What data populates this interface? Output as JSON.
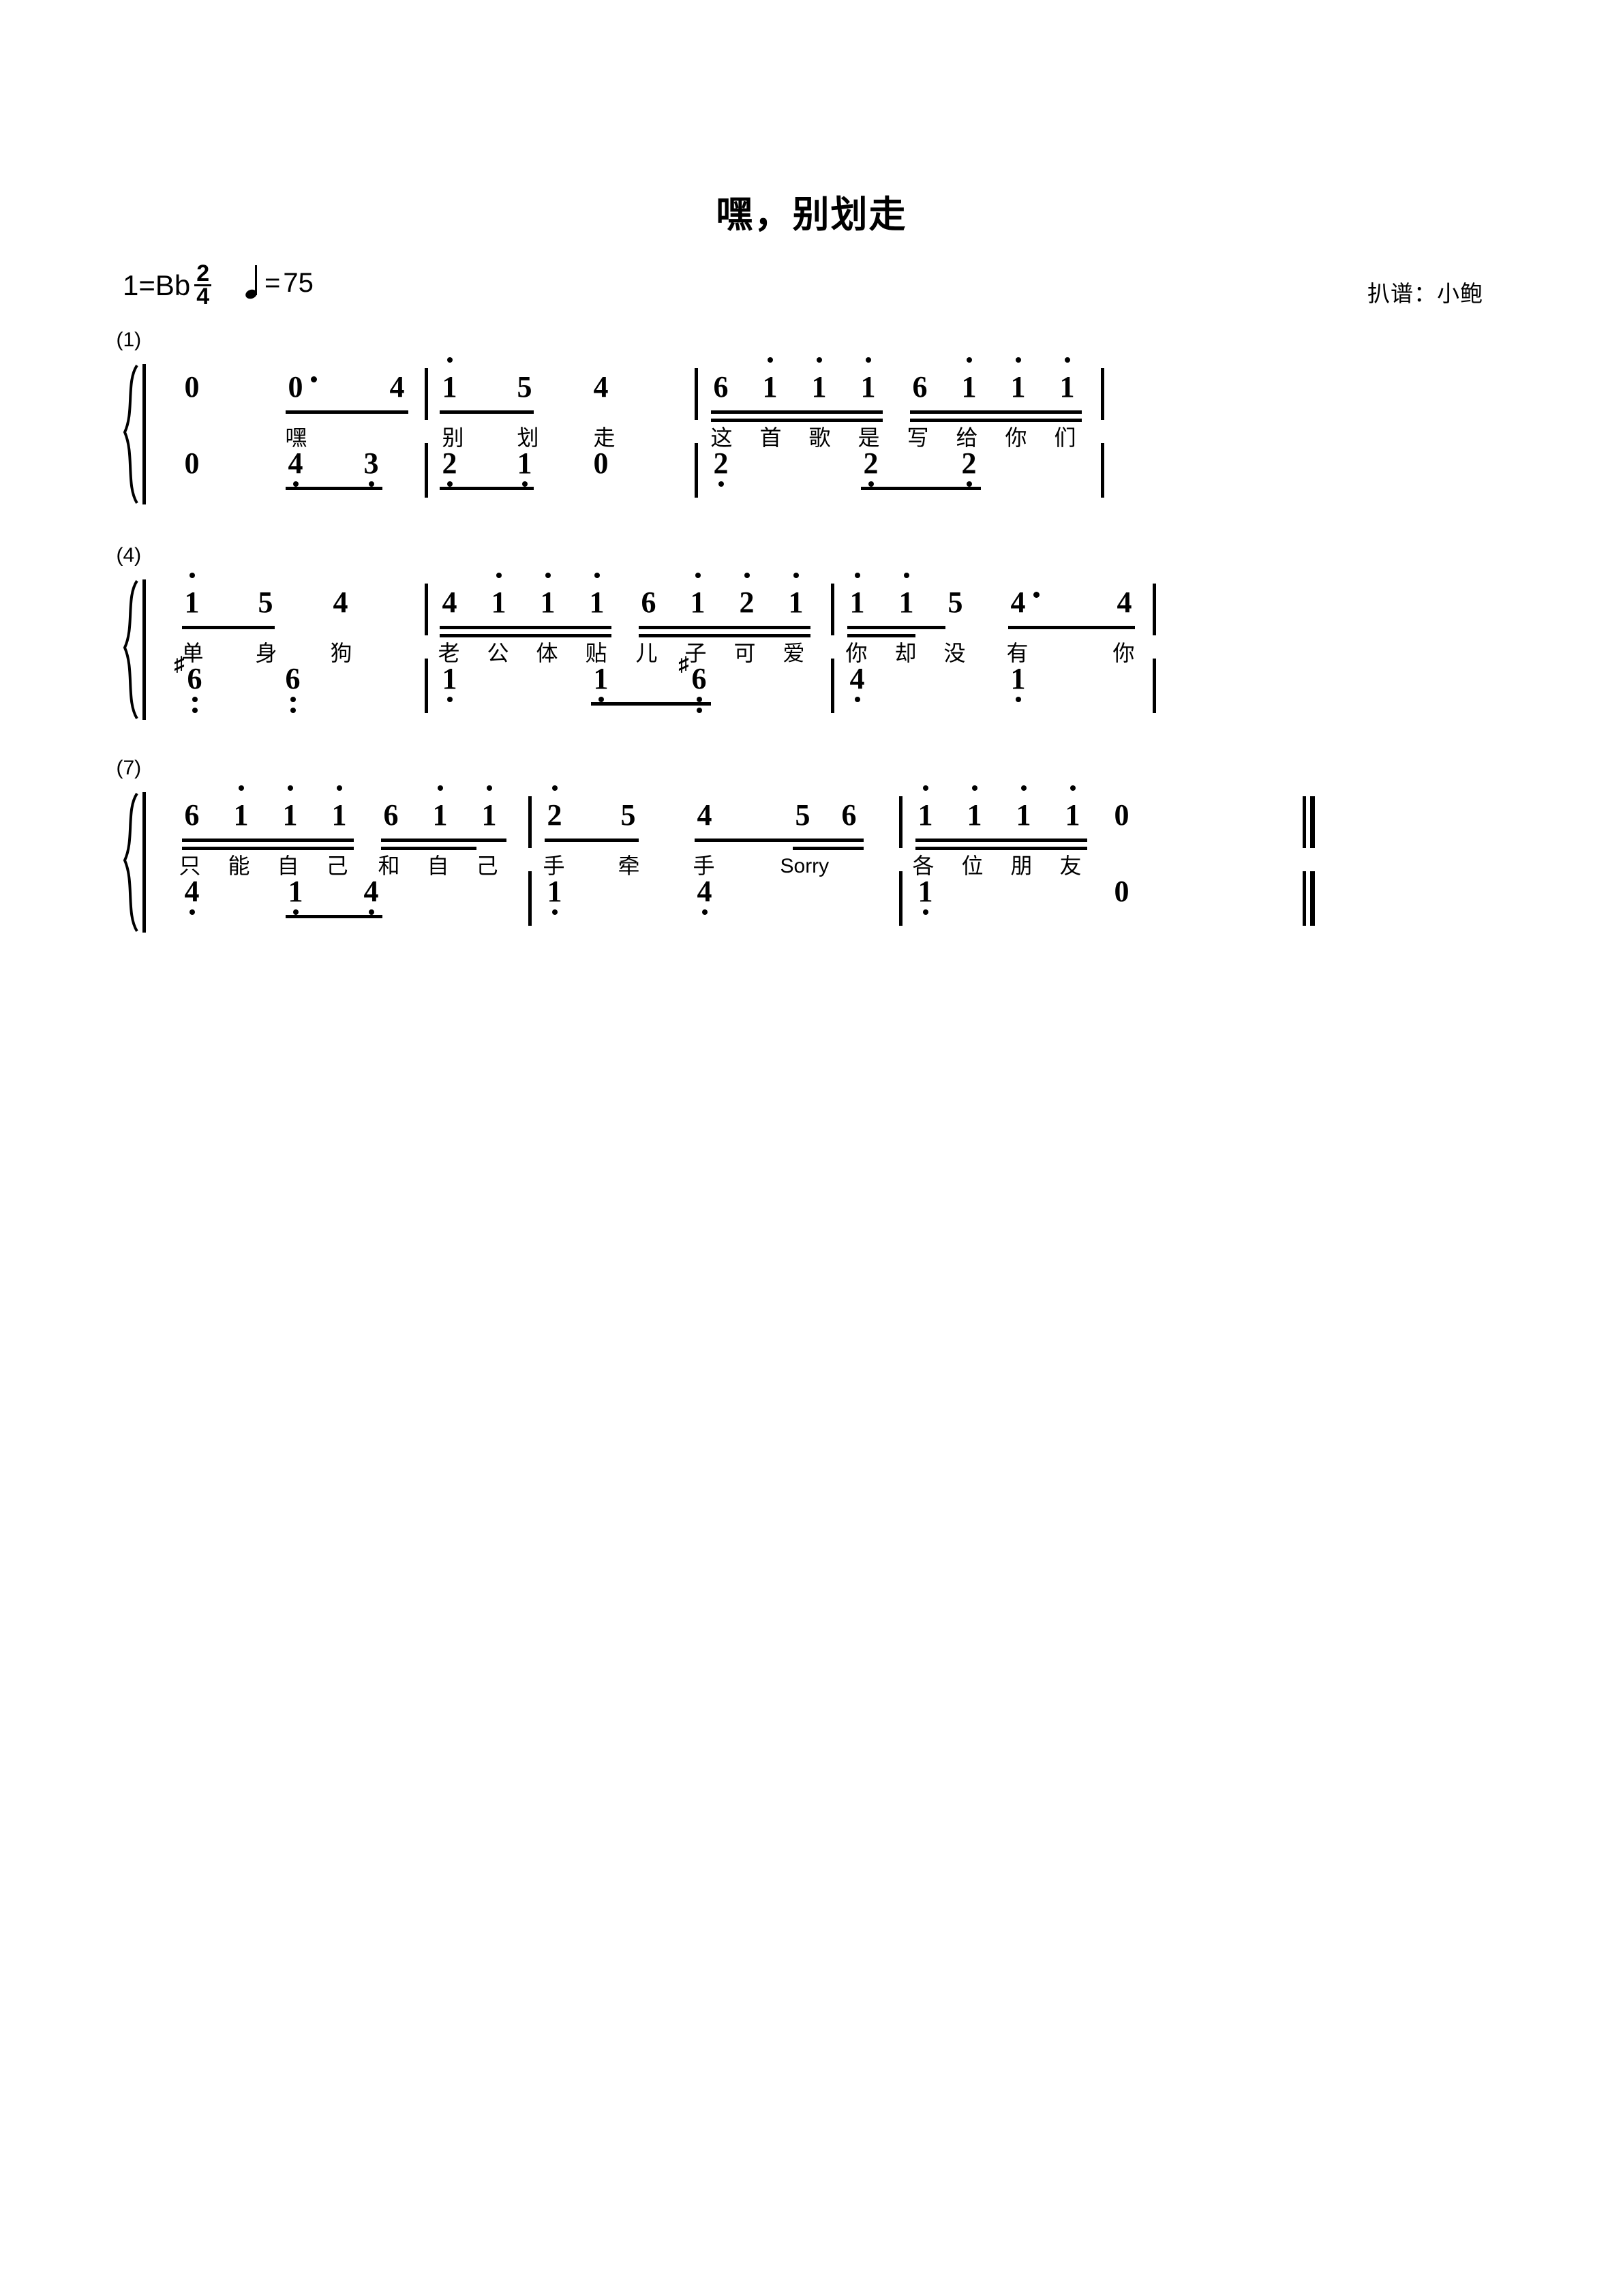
{
  "header": {
    "title": "嘿，别划走",
    "key_label": "1=Bb",
    "time_num": "2",
    "time_den": "4",
    "tempo_note": "quarter-note",
    "tempo_eq": "=",
    "tempo_bpm": "75",
    "credit": "扒谱：小鲍"
  },
  "systems": [
    {
      "number": "(1)",
      "measures": [
        {
          "melody": [
            {
              "num": "0",
              "octave": "none",
              "dot": false
            },
            {
              "num": "0",
              "octave": "none",
              "dot": true,
              "beamed": true
            },
            {
              "num": "4",
              "octave": "none",
              "dot": false,
              "beamed": true,
              "sub": true
            }
          ],
          "bass": [
            {
              "num": "0",
              "octave": "none"
            }
          ],
          "lyrics": [
            "嘿"
          ]
        },
        {
          "melody": [
            {
              "num": "1",
              "octave": "up",
              "beamed": true
            },
            {
              "num": "5",
              "octave": "none",
              "beamed": true
            },
            {
              "num": "4",
              "octave": "none"
            }
          ],
          "bass": [
            {
              "num": "4",
              "octave": "down",
              "beamed": true
            },
            {
              "num": "3",
              "octave": "down",
              "beamed": true
            },
            {
              "num": "2",
              "octave": "down"
            },
            {
              "num": "1",
              "octave": "down"
            },
            {
              "num": "0",
              "octave": "none"
            }
          ],
          "lyrics": [
            "别",
            "划",
            "走"
          ]
        },
        {
          "melody": [
            {
              "num": "6",
              "octave": "none"
            },
            {
              "num": "1",
              "octave": "up"
            },
            {
              "num": "1",
              "octave": "up"
            },
            {
              "num": "1",
              "octave": "up"
            },
            {
              "num": "6",
              "octave": "none"
            },
            {
              "num": "1",
              "octave": "up"
            },
            {
              "num": "1",
              "octave": "up"
            },
            {
              "num": "1",
              "octave": "up"
            }
          ],
          "bass": [
            {
              "num": "2",
              "octave": "down"
            },
            {
              "num": "2",
              "octave": "down"
            },
            {
              "num": "2",
              "octave": "down"
            }
          ],
          "lyrics": [
            "这",
            "首",
            "歌",
            "是",
            "写",
            "给",
            "你",
            "们"
          ]
        }
      ]
    },
    {
      "number": "(4)",
      "measures": [
        {
          "melody": [
            {
              "num": "1",
              "octave": "up",
              "beamed": true
            },
            {
              "num": "5",
              "octave": "none",
              "beamed": true
            },
            {
              "num": "4",
              "octave": "none"
            }
          ],
          "bass": [
            {
              "num": "6",
              "octave": "down2",
              "accidental": "#"
            },
            {
              "num": "6",
              "octave": "down2"
            }
          ],
          "lyrics": [
            "单",
            "身",
            "狗"
          ]
        },
        {
          "melody": [
            {
              "num": "4",
              "octave": "none"
            },
            {
              "num": "1",
              "octave": "up"
            },
            {
              "num": "1",
              "octave": "up"
            },
            {
              "num": "1",
              "octave": "up"
            },
            {
              "num": "6",
              "octave": "none"
            },
            {
              "num": "1",
              "octave": "up"
            },
            {
              "num": "2",
              "octave": "up"
            },
            {
              "num": "1",
              "octave": "up"
            }
          ],
          "bass": [
            {
              "num": "1",
              "octave": "down"
            },
            {
              "num": "1",
              "octave": "down"
            },
            {
              "num": "6",
              "octave": "down2",
              "accidental": "#"
            }
          ],
          "lyrics": [
            "老",
            "公",
            "体",
            "贴",
            "儿",
            "子",
            "可",
            "爱"
          ]
        },
        {
          "melody": [
            {
              "num": "1",
              "octave": "up"
            },
            {
              "num": "1",
              "octave": "up"
            },
            {
              "num": "5",
              "octave": "none"
            },
            {
              "num": "4",
              "octave": "none",
              "dot": true
            },
            {
              "num": "4",
              "octave": "none",
              "sub": true
            }
          ],
          "bass": [
            {
              "num": "4",
              "octave": "down"
            },
            {
              "num": "1",
              "octave": "down"
            }
          ],
          "lyrics": [
            "你",
            "却",
            "没",
            "有",
            "你"
          ]
        }
      ]
    },
    {
      "number": "(7)",
      "measures": [
        {
          "melody": [
            {
              "num": "6",
              "octave": "none"
            },
            {
              "num": "1",
              "octave": "up"
            },
            {
              "num": "1",
              "octave": "up"
            },
            {
              "num": "1",
              "octave": "up"
            },
            {
              "num": "6",
              "octave": "none"
            },
            {
              "num": "1",
              "octave": "up"
            },
            {
              "num": "1",
              "octave": "up"
            }
          ],
          "bass": [
            {
              "num": "4",
              "octave": "down"
            },
            {
              "num": "1",
              "octave": "down"
            },
            {
              "num": "4",
              "octave": "down"
            }
          ],
          "lyrics": [
            "只",
            "能",
            "自",
            "己",
            "和",
            "自",
            "己"
          ]
        },
        {
          "melody": [
            {
              "num": "2",
              "octave": "up"
            },
            {
              "num": "5",
              "octave": "none"
            },
            {
              "num": "4",
              "octave": "none"
            },
            {
              "num": "5",
              "octave": "none"
            },
            {
              "num": "6",
              "octave": "none"
            }
          ],
          "bass": [
            {
              "num": "1",
              "octave": "down"
            },
            {
              "num": "4",
              "octave": "down"
            }
          ],
          "lyrics": [
            "手",
            "牵",
            "手",
            "Sorry"
          ]
        },
        {
          "melody": [
            {
              "num": "1",
              "octave": "up"
            },
            {
              "num": "1",
              "octave": "up"
            },
            {
              "num": "1",
              "octave": "up"
            },
            {
              "num": "1",
              "octave": "up"
            },
            {
              "num": "0",
              "octave": "none"
            }
          ],
          "bass": [
            {
              "num": "1",
              "octave": "down"
            },
            {
              "num": "0",
              "octave": "none"
            }
          ],
          "lyrics": [
            "各",
            "位",
            "朋",
            "友"
          ]
        }
      ]
    }
  ],
  "notation": {
    "score_type": "jianpu",
    "sharp_glyph": "♯"
  }
}
